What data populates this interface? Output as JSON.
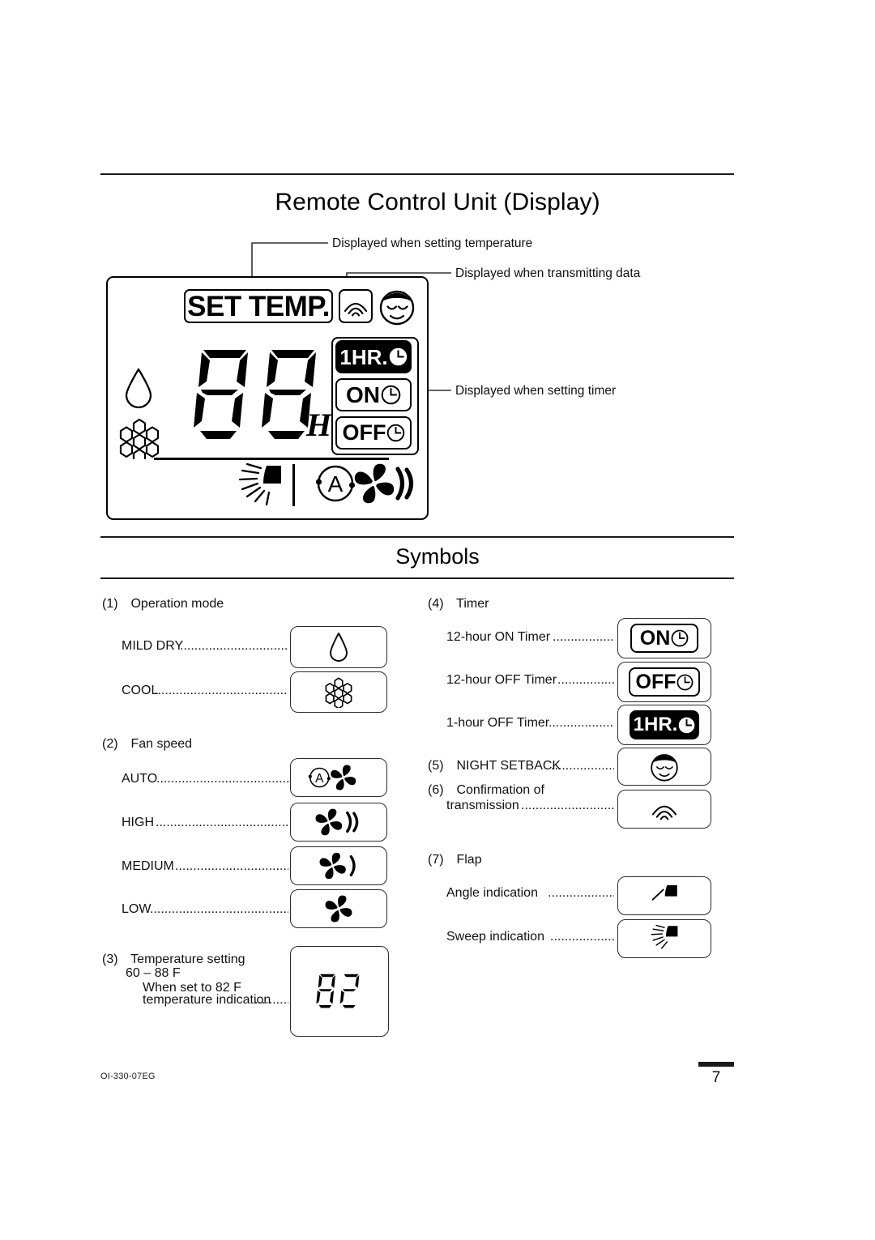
{
  "header": {
    "title": "Remote Control Unit (Display)",
    "symbols_title": "Symbols"
  },
  "callouts": [
    {
      "id": "set-temperature",
      "text": "Displayed when setting temperature"
    },
    {
      "id": "transmitting-data",
      "text": "Displayed when transmitting data"
    },
    {
      "id": "setting-timer",
      "text": "Displayed when setting timer"
    }
  ],
  "lcd": {
    "set_temp_label": "SET TEMP.",
    "temperature_digits": "88",
    "hour_suffix": "H",
    "timer_badges": [
      {
        "id": "one-hour",
        "label": "1HR.",
        "inverted": true
      },
      {
        "id": "on",
        "label": "ON",
        "inverted": false
      },
      {
        "id": "off",
        "label": "OFF",
        "inverted": false
      }
    ],
    "icons": [
      "wifi-transmission-icon",
      "sleeping-face-icon",
      "water-drop-icon",
      "snowflake-icon",
      "sweep-flap-icon",
      "auto-fan-icon"
    ]
  },
  "symbols": {
    "groups": [
      {
        "number": "(1)",
        "title": "Operation mode",
        "items": [
          {
            "label": "MILD DRY",
            "icon": "water-drop-icon",
            "box": "wide"
          },
          {
            "label": "COOL",
            "icon": "snowflake-icon",
            "box": "wide"
          }
        ]
      },
      {
        "number": "(2)",
        "title": "Fan speed",
        "items": [
          {
            "label": "AUTO",
            "icon": "auto-fan-icon",
            "box": "wide"
          },
          {
            "label": "HIGH",
            "icon": "fan-high-icon",
            "box": "wide"
          },
          {
            "label": "MEDIUM",
            "icon": "fan-medium-icon",
            "box": "wide"
          },
          {
            "label": "LOW",
            "icon": "fan-low-icon",
            "box": "wide"
          }
        ]
      },
      {
        "number": "(3)",
        "title": "Temperature setting",
        "lines": [
          "60 – 88  F",
          "When set to 82  F",
          "temperature indication"
        ],
        "items": [
          {
            "label": "",
            "icon": "seven-segment-82-icon",
            "box": "square",
            "value": "82"
          }
        ]
      },
      {
        "number": "(4)",
        "title": "Timer",
        "items": [
          {
            "label": "12-hour ON Timer",
            "icon": "timer-on-badge-icon",
            "box": "wide"
          },
          {
            "label": "12-hour OFF Timer",
            "icon": "timer-off-badge-icon",
            "box": "wide"
          },
          {
            "label": "1-hour OFF Timer",
            "icon": "timer-1hr-badge-icon",
            "box": "wide"
          }
        ]
      },
      {
        "number": "(5)",
        "title": "NIGHT SETBACK",
        "inline": true,
        "items": [
          {
            "label": "NIGHT SETBACK",
            "icon": "sleeping-face-icon",
            "box": "wide"
          }
        ]
      },
      {
        "number": "(6)",
        "title": "Confirmation of",
        "title2": "transmission",
        "items": [
          {
            "label": "transmission",
            "icon": "wifi-transmission-icon",
            "box": "wide"
          }
        ]
      },
      {
        "number": "(7)",
        "title": "Flap",
        "items": [
          {
            "label": "Angle indication",
            "icon": "flap-angle-icon",
            "box": "wide"
          },
          {
            "label": "Sweep indication",
            "icon": "flap-sweep-icon",
            "box": "wide"
          }
        ]
      }
    ]
  },
  "footer": {
    "document_code": "OI-330-07EG",
    "page_number": "7"
  }
}
